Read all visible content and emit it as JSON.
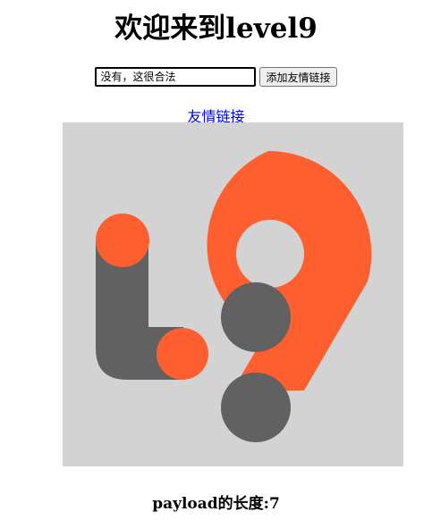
{
  "page": {
    "title": "欢迎来到level9"
  },
  "form": {
    "keyword_value": "没有，这很合法",
    "submit_label": "添加友情链接"
  },
  "link": {
    "text": "友情链接"
  },
  "logo": {
    "description_icon": "level9-logo-icon",
    "colors": {
      "background": "#d3d3d3",
      "orange": "#ff5e2e",
      "gray": "#616161"
    }
  },
  "payload": {
    "label": "payload的长度:",
    "length": "7"
  }
}
